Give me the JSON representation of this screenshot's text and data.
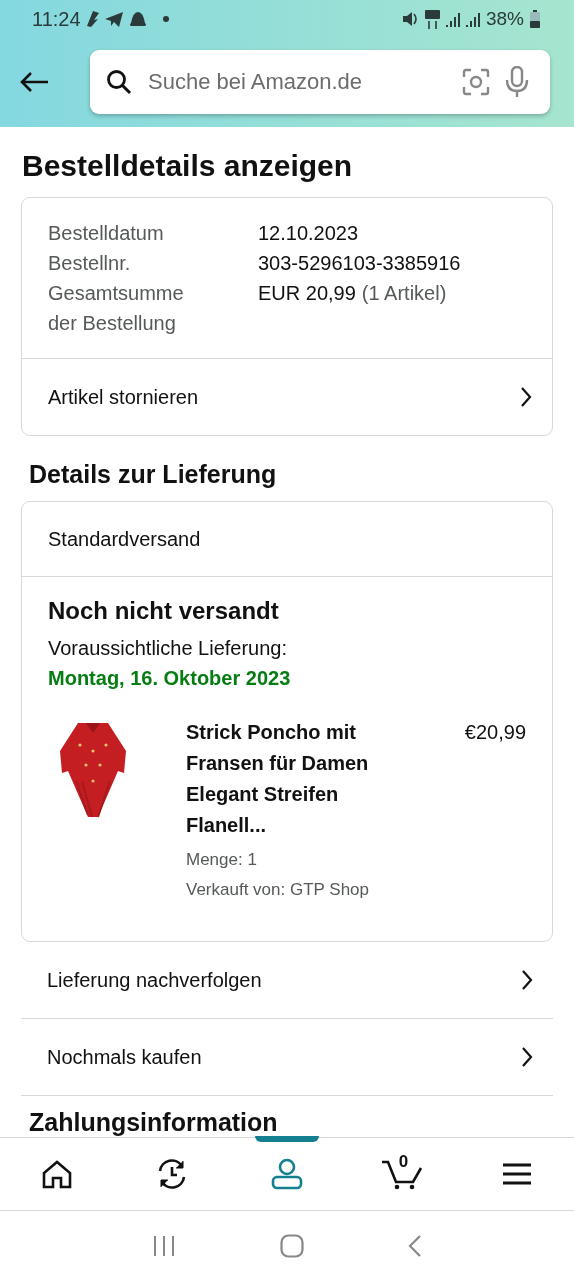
{
  "status_bar": {
    "time": "11:24",
    "battery": "38%"
  },
  "search": {
    "placeholder": "Suche bei Amazon.de"
  },
  "title": "Bestelldetails anzeigen",
  "order_summary": {
    "rows": [
      {
        "label": "Bestelldatum",
        "value": "12.10.2023"
      },
      {
        "label": "Bestellnr.",
        "value": "303-5296103-3385916"
      },
      {
        "label": "Gesamtsumme der Bestellung",
        "value": "EUR 20,99",
        "note": "(1 Artikel)"
      }
    ],
    "action": "Artikel stornieren"
  },
  "delivery": {
    "heading": "Details zur Lieferung",
    "method": "Standardversand",
    "status": "Noch nicht versandt",
    "estimate_label": "Voraussichtliche Lieferung:",
    "estimate_date": "Montag, 16. Oktober 2023",
    "item": {
      "title": "Strick Poncho mit Fransen für Damen Elegant Streifen Flanell...",
      "price": "€20,99",
      "quantity": "Menge: 1",
      "seller": "Verkauft von: GTP Shop"
    }
  },
  "actions": [
    "Lieferung nachverfolgen",
    "Nochmals kaufen"
  ],
  "payment_heading": "Zahlungsinformation",
  "bottom_nav": [
    {
      "kind": "home",
      "selected": false
    },
    {
      "kind": "history",
      "selected": false
    },
    {
      "kind": "account",
      "selected": true
    },
    {
      "kind": "cart",
      "selected": false,
      "count": "0"
    },
    {
      "kind": "menu",
      "selected": false
    }
  ]
}
